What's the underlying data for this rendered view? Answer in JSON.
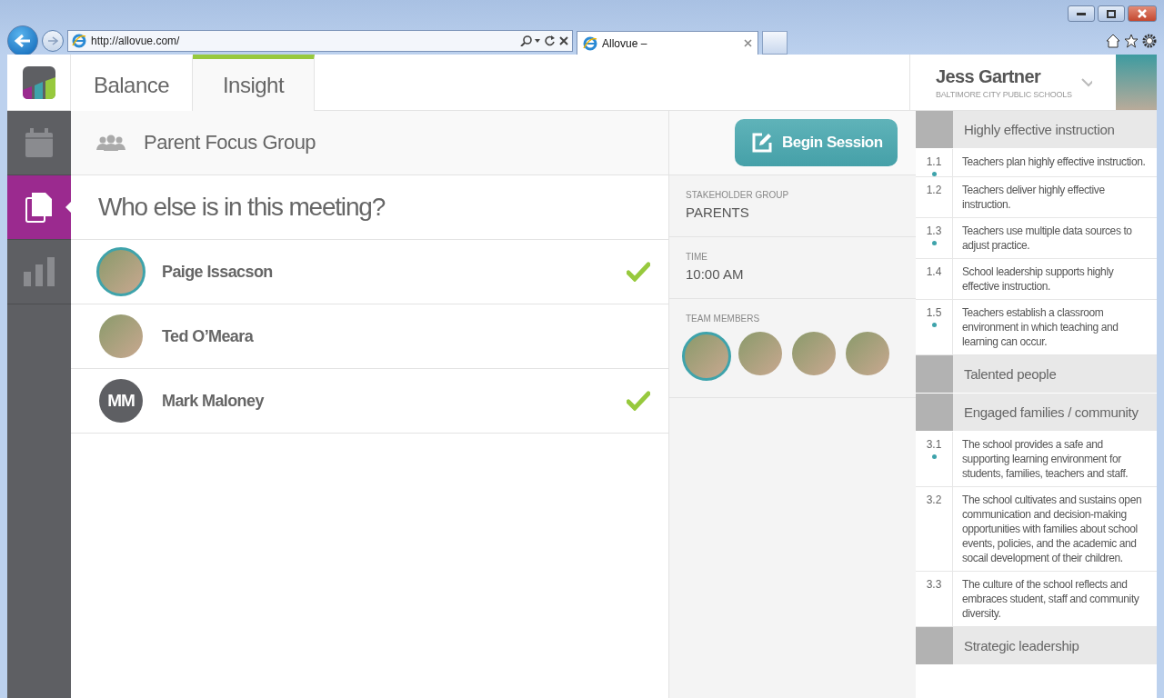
{
  "browser": {
    "address": "http://allovue.com/",
    "tab_title": "Allovue –"
  },
  "app_tabs": [
    {
      "label": "Balance",
      "selected": false
    },
    {
      "label": "Insight",
      "selected": true
    }
  ],
  "user": {
    "name": "Jess Gartner",
    "organization": "BALTIMORE CITY PUBLIC SCHOOLS"
  },
  "sidebar": {
    "items": [
      {
        "selected": false
      },
      {
        "selected": true
      },
      {
        "selected": false
      }
    ]
  },
  "session": {
    "title": "Parent Focus Group",
    "begin_button": "Begin Session"
  },
  "question": "Who else is in this meeting?",
  "participants": [
    {
      "name": "Paige Issacson",
      "kind": "photo",
      "ringed": true,
      "checked": true
    },
    {
      "name": "Ted O’Meara",
      "kind": "photo",
      "ringed": false,
      "checked": false
    },
    {
      "name": "Mark Maloney",
      "kind": "initials",
      "initials": "MM",
      "ringed": false,
      "checked": true
    }
  ],
  "details": [
    {
      "label": "STAKEHOLDER GROUP",
      "value": "PARENTS"
    },
    {
      "label": "TIME",
      "value": "10:00 AM"
    }
  ],
  "team": {
    "label": "TEAM MEMBERS",
    "members": [
      {
        "ringed": true
      },
      {
        "ringed": false
      },
      {
        "ringed": false
      },
      {
        "ringed": false
      }
    ]
  },
  "standards": [
    {
      "title": "Highly effective instruction",
      "children": [
        {
          "number": "1.1",
          "text": "Teachers plan highly effective instruction.",
          "marked": true
        },
        {
          "number": "1.2",
          "text": "Teachers deliver highly effective instruction.",
          "marked": false
        },
        {
          "number": "1.3",
          "text": "Teachers use multiple data sources to adjust practice.",
          "marked": true
        },
        {
          "number": "1.4",
          "text": "School leadership supports highly effective instruction.",
          "marked": false
        },
        {
          "number": "1.5",
          "text": "Teachers establish a classroom environment in which teaching and learning can occur.",
          "marked": true
        }
      ]
    },
    {
      "title": "Talented people"
    },
    {
      "title": "Engaged families / community",
      "children": [
        {
          "number": "3.1",
          "text": "The school provides a safe and supporting learning environment for students, families, teachers and staff.",
          "marked": true
        },
        {
          "number": "3.2",
          "text": "The school cultivates and sustains open communication and decision-making opportunities with families about school events, policies, and the academic and socail development of their children.",
          "marked": false
        },
        {
          "number": "3.3",
          "text": "The culture of the school reflects and embraces student, staff and community diversity.",
          "marked": false
        }
      ]
    },
    {
      "title": "Strategic leadership"
    }
  ]
}
